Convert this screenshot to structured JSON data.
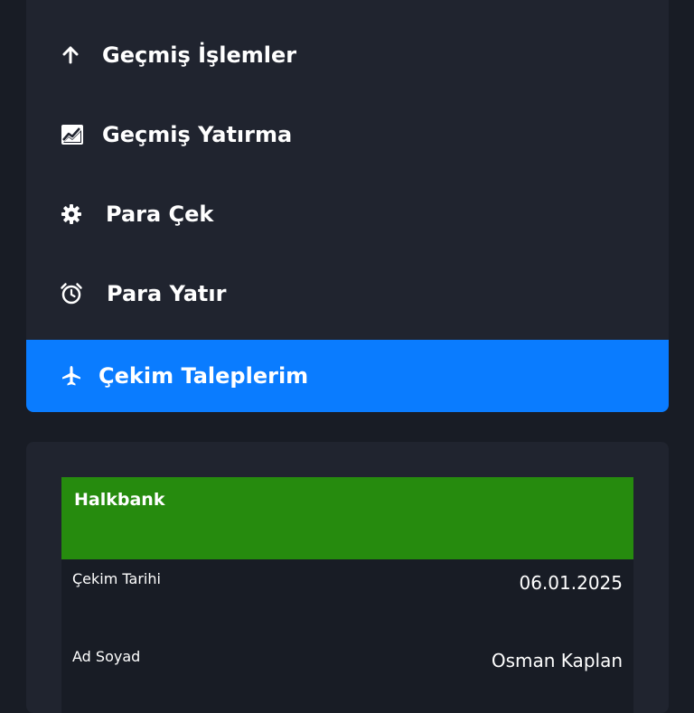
{
  "menu": {
    "items": [
      {
        "label": "Geçmiş İşlemler",
        "icon": "arrow-up-icon"
      },
      {
        "label": "Geçmiş Yatırma",
        "icon": "chart-image-icon"
      },
      {
        "label": "Para Çek",
        "icon": "gear-icon"
      },
      {
        "label": "Para Yatır",
        "icon": "alarm-clock-icon"
      },
      {
        "label": "Çekim Taleplerim",
        "icon": "airplane-icon",
        "active": true
      }
    ]
  },
  "withdrawal": {
    "bank_name": "Halkbank",
    "header_color": "#268b0e",
    "rows": [
      {
        "label": "Çekim Tarihi",
        "value": "06.01.2025"
      },
      {
        "label": "Ad Soyad",
        "value": "Osman Kaplan"
      }
    ]
  },
  "colors": {
    "active": "#0a7cff",
    "card": "#20242f",
    "background": "#181c25"
  }
}
